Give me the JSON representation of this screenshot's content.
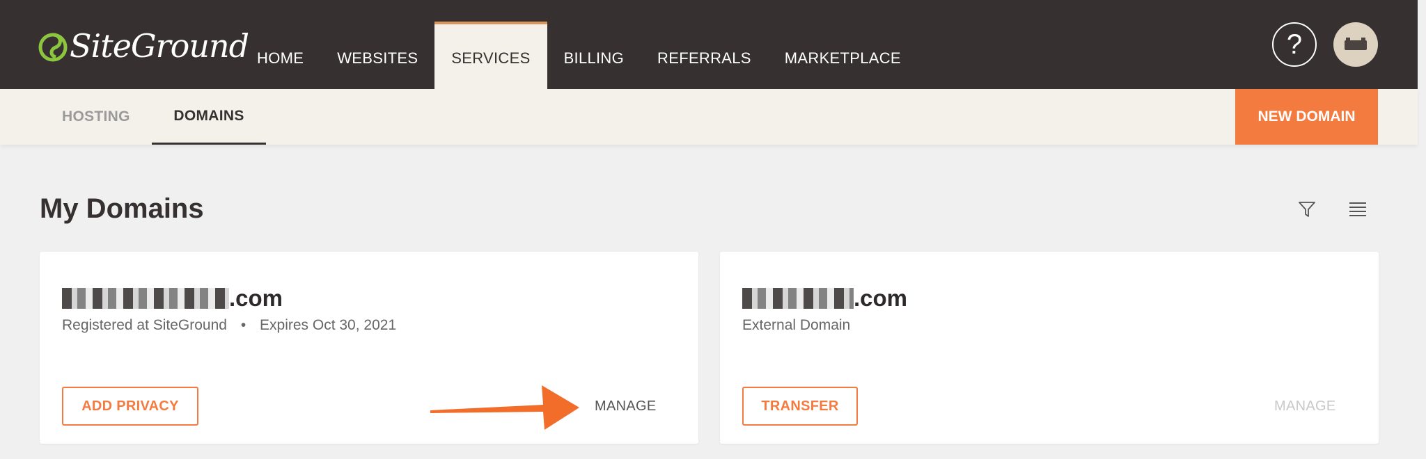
{
  "colors": {
    "topbar": "#363130",
    "accent": "#f47b3f",
    "subnav_bg": "#f4f1ea",
    "arrow": "#f26c2a"
  },
  "brand": {
    "logo_text": "SiteGround"
  },
  "nav": {
    "items": [
      {
        "label": "HOME"
      },
      {
        "label": "WEBSITES"
      },
      {
        "label": "SERVICES",
        "active": true
      },
      {
        "label": "BILLING"
      },
      {
        "label": "REFERRALS"
      },
      {
        "label": "MARKETPLACE"
      }
    ]
  },
  "header": {
    "help_symbol": "?",
    "help_icon": "help-circle-icon",
    "avatar_icon": "avatar-icon"
  },
  "subnav": {
    "tabs": [
      {
        "label": "HOSTING"
      },
      {
        "label": "DOMAINS",
        "active": true
      }
    ],
    "new_domain_label": "NEW DOMAIN"
  },
  "page": {
    "title": "My Domains",
    "filter_icon": "filter-icon",
    "list_icon": "list-view-icon"
  },
  "domains": [
    {
      "name_suffix": ".com",
      "registered": "Registered at SiteGround",
      "separator": "•",
      "expires": "Expires Oct 30, 2021",
      "action_label": "ADD PRIVACY",
      "manage_label": "MANAGE",
      "manage_enabled": true
    },
    {
      "name_suffix": ".com",
      "registered": "External Domain",
      "action_label": "TRANSFER",
      "manage_label": "MANAGE",
      "manage_enabled": false
    }
  ]
}
